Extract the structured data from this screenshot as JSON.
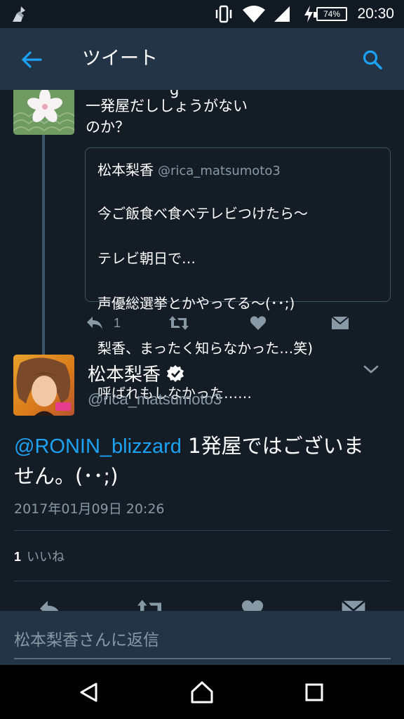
{
  "status_bar": {
    "battery_percent": "74%",
    "time": "20:30",
    "icons": [
      "broom-icon",
      "vibrate-icon",
      "wifi-icon",
      "signal-icon",
      "charging-icon",
      "battery-icon"
    ]
  },
  "app_bar": {
    "title": "ツイート",
    "back_icon": "arrow-left-icon",
    "search_icon": "search-icon",
    "accent": "#1da1f2"
  },
  "parent_tweet": {
    "text_clipped_top": "g",
    "text_lines": [
      "一発屋だししょうがない",
      "のか？"
    ],
    "quote": {
      "name": "松本梨香",
      "handle": "@rica_matsumoto3",
      "lines": [
        "今ご飯食べ食べテレビつけたら〜",
        "テレビ朝日で…",
        "声優総選挙とかやってる〜(･･;)",
        "梨香、まったく知らなかった…笑)",
        "呼ばれもしなかった……"
      ]
    },
    "actions": {
      "reply_count": "1"
    }
  },
  "main_tweet": {
    "name": "松本梨香",
    "verified": true,
    "handle": "@rica_matsumoto3",
    "mention": "@RONIN_blizzard",
    "text_line1": " 1発屋ではございま",
    "text_line2": "せん。(･･;)",
    "timestamp": "2017年01月09日 20:26",
    "likes_count": "1",
    "likes_label": "いいね"
  },
  "reply_bar": {
    "placeholder": "松本梨香さんに返信"
  },
  "colors": {
    "background": "#141d26",
    "header": "#243447",
    "muted": "#8899a6",
    "link": "#1da1f2"
  }
}
